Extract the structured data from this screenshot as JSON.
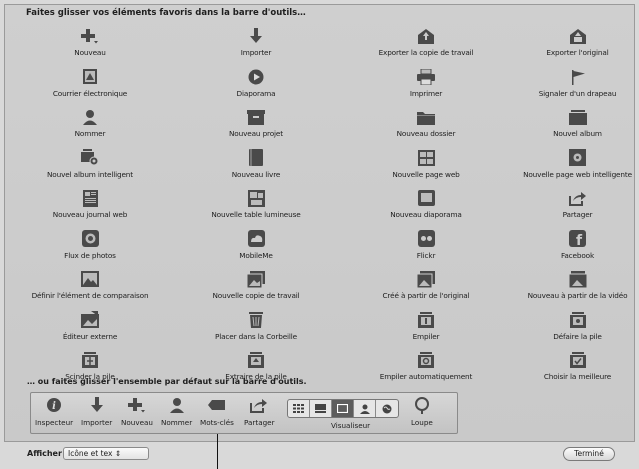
{
  "instruction": "Faites glisser vos éléments favoris dans la barre d'outils…",
  "grid_items": [
    {
      "label": "Nouveau",
      "icon": "plus-icon"
    },
    {
      "label": "Importer",
      "icon": "download-arrow-icon"
    },
    {
      "label": "Exporter la copie de travail",
      "icon": "export-icon"
    },
    {
      "label": "Exporter l'original",
      "icon": "export-original-icon"
    },
    {
      "label": "Courrier électronique",
      "icon": "mail-stamp-icon"
    },
    {
      "label": "Diaporama",
      "icon": "play-icon"
    },
    {
      "label": "Imprimer",
      "icon": "printer-icon"
    },
    {
      "label": "Signaler d'un drapeau",
      "icon": "flag-icon"
    },
    {
      "label": "Nommer",
      "icon": "person-icon"
    },
    {
      "label": "Nouveau projet",
      "icon": "project-box-icon"
    },
    {
      "label": "Nouveau dossier",
      "icon": "folder-icon"
    },
    {
      "label": "Nouvel album",
      "icon": "album-icon"
    },
    {
      "label": "Nouvel album intelligent",
      "icon": "smart-album-icon"
    },
    {
      "label": "Nouveau livre",
      "icon": "book-icon"
    },
    {
      "label": "Nouvelle page web",
      "icon": "web-page-icon"
    },
    {
      "label": "Nouvelle page web intelligente",
      "icon": "smart-web-page-icon"
    },
    {
      "label": "Nouveau journal web",
      "icon": "web-journal-icon"
    },
    {
      "label": "Nouvelle table lumineuse",
      "icon": "light-table-icon"
    },
    {
      "label": "Nouveau diaporama",
      "icon": "slideshow-icon"
    },
    {
      "label": "Partager",
      "icon": "share-icon"
    },
    {
      "label": "Flux de photos",
      "icon": "photo-stream-icon"
    },
    {
      "label": "MobileMe",
      "icon": "mobileme-icon"
    },
    {
      "label": "Flickr",
      "icon": "flickr-icon"
    },
    {
      "label": "Facebook",
      "icon": "facebook-icon"
    },
    {
      "label": "Définir l'élément de comparaison",
      "icon": "compare-icon"
    },
    {
      "label": "Nouvelle copie de travail",
      "icon": "new-version-icon"
    },
    {
      "label": "Créé à partir de l'original",
      "icon": "from-original-icon"
    },
    {
      "label": "Nouveau à partir de la vidéo",
      "icon": "from-video-icon"
    },
    {
      "label": "Éditeur externe",
      "icon": "external-editor-icon"
    },
    {
      "label": "Placer dans la Corbeille",
      "icon": "trash-icon"
    },
    {
      "label": "Empiler",
      "icon": "stack-icon"
    },
    {
      "label": "Défaire la pile",
      "icon": "unstack-icon"
    },
    {
      "label": "Scinder la pile",
      "icon": "split-stack-icon"
    },
    {
      "label": "Extraire de la pile",
      "icon": "extract-stack-icon"
    },
    {
      "label": "Empiler automatiquement",
      "icon": "auto-stack-icon"
    },
    {
      "label": "Choisir la meilleure",
      "icon": "pick-best-icon"
    }
  ],
  "default_text": "… ou faites glisser l'ensemble par défaut sur la barre d'outils.",
  "default_set": {
    "inspecteur": "Inspecteur",
    "importer": "Importer",
    "nouveau": "Nouveau",
    "nommer": "Nommer",
    "mots_cles": "Mots-clés",
    "partager": "Partager",
    "visualiseur": "Visualiseur",
    "loupe": "Loupe"
  },
  "bottom": {
    "afficher_label": "Afficher",
    "afficher_value": "Icône et tex ⇕",
    "done_label": "Terminé"
  },
  "colors": {
    "icon": "#4a4a4a",
    "sheet_bg": "#cccccc",
    "active_segment": "#5d5d5d"
  }
}
